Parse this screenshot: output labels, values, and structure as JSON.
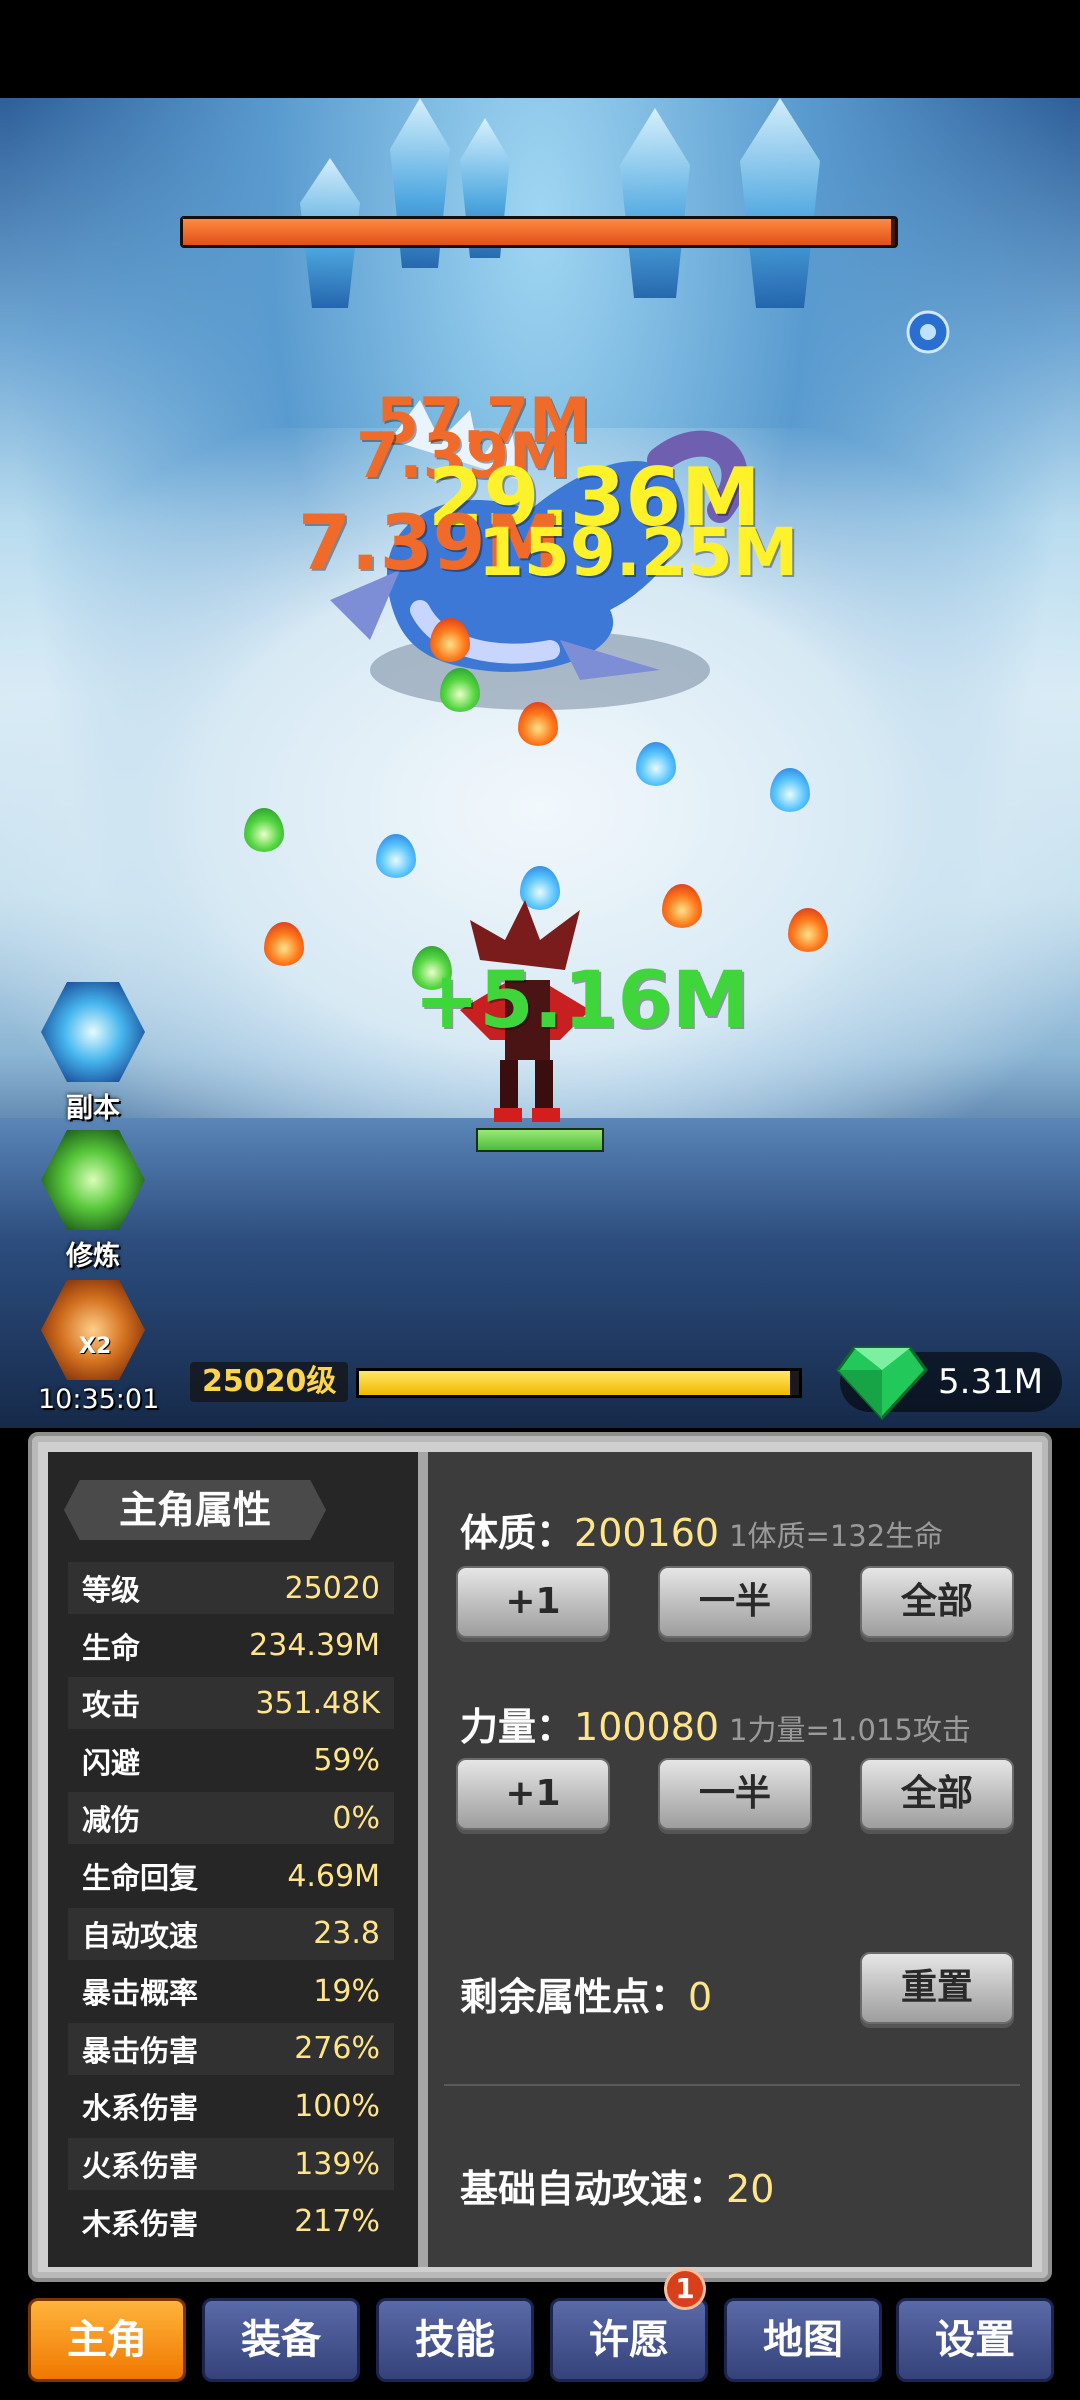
{
  "battle": {
    "boss_hp_fraction": 0.995,
    "damage_numbers": [
      "57.7M",
      "7.39M",
      "29.36M",
      "7.39M",
      "159.25M"
    ],
    "heal_number": "+5.16M",
    "hero_hp_fraction": 1.0
  },
  "side_buttons": [
    {
      "label": "副本",
      "icon": "dungeon-portal-icon"
    },
    {
      "label": "修炼",
      "icon": "cultivation-icon"
    },
    {
      "label": "10:35:01",
      "icon": "x2-boost-icon",
      "badge": "X2"
    }
  ],
  "level_bar": {
    "level_text": "25020级",
    "xp_fraction": 0.98
  },
  "gems": {
    "value": "5.31M",
    "icon": "emerald-gem-icon"
  },
  "panel": {
    "title": "主角属性",
    "stats": [
      {
        "k": "等级",
        "v": "25020"
      },
      {
        "k": "生命",
        "v": "234.39M"
      },
      {
        "k": "攻击",
        "v": "351.48K"
      },
      {
        "k": "闪避",
        "v": "59%"
      },
      {
        "k": "减伤",
        "v": "0%"
      },
      {
        "k": "生命回复",
        "v": "4.69M"
      },
      {
        "k": "自动攻速",
        "v": "23.8"
      },
      {
        "k": "暴击概率",
        "v": "19%"
      },
      {
        "k": "暴击伤害",
        "v": "276%"
      },
      {
        "k": "水系伤害",
        "v": "100%"
      },
      {
        "k": "火系伤害",
        "v": "139%"
      },
      {
        "k": "木系伤害",
        "v": "217%"
      }
    ],
    "constitution": {
      "label": "体质：",
      "value": "200160",
      "note": "1体质=132生命"
    },
    "strength": {
      "label": "力量：",
      "value": "100080",
      "note": "1力量=1.015攻击"
    },
    "buttons": {
      "plus_one": "+1",
      "half": "一半",
      "all": "全部",
      "reset": "重置"
    },
    "remaining": {
      "label": "剩余属性点：",
      "value": "0"
    },
    "base_speed": {
      "label": "基础自动攻速：",
      "value": "20"
    }
  },
  "nav": {
    "tabs": [
      "主角",
      "装备",
      "技能",
      "许愿",
      "地图",
      "设置"
    ],
    "active": 0,
    "wish_badge": "1"
  },
  "colors": {
    "accent": "#f07800",
    "gold_text": "#ffe58a",
    "tab_blue": "#35427a"
  }
}
